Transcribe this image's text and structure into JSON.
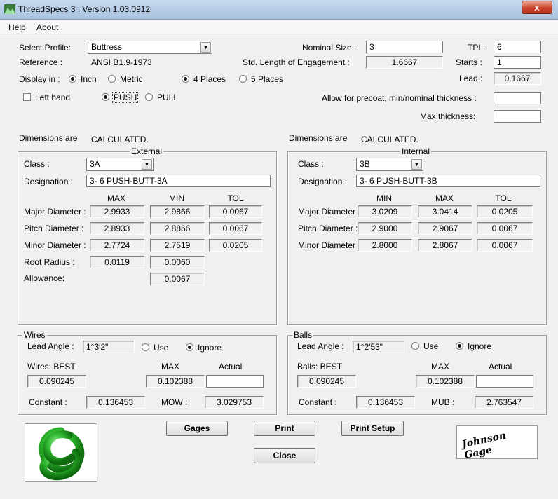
{
  "window": {
    "title": "ThreadSpecs 3 : Version 1.03.0912",
    "close": "x"
  },
  "menu": {
    "help": "Help",
    "about": "About"
  },
  "top": {
    "profile_label": "Select Profile:",
    "profile_value": "Buttress",
    "reference_label": "Reference :",
    "reference_value": "ANSI B1.9-1973",
    "display_label": "Display in :",
    "inch": "Inch",
    "metric": "Metric",
    "places4": "4 Places",
    "places5": "5 Places",
    "left_hand": "Left hand",
    "push": "PUSH",
    "pull": "PULL",
    "nominal_label": "Nominal Size :",
    "nominal_value": "3",
    "std_len_label": "Std. Length of Engagement :",
    "std_len_value": "1.6667",
    "tpi_label": "TPI :",
    "tpi_value": "6",
    "starts_label": "Starts :",
    "starts_value": "1",
    "lead_label": "Lead :",
    "lead_value": "0.1667",
    "precoat_label": "Allow for precoat, min/nominal thickness :",
    "max_thick_label": "Max thickness:"
  },
  "dims": {
    "label": "Dimensions are",
    "status": "CALCULATED."
  },
  "external": {
    "title": "External",
    "class_label": "Class :",
    "class_value": "3A",
    "designation_label": "Designation :",
    "designation_value": "3-  6  PUSH-BUTT-3A",
    "col1": "MAX",
    "col2": "MIN",
    "col3": "TOL",
    "rows": [
      {
        "label": "Major Diameter :",
        "a": "2.9933",
        "b": "2.9866",
        "c": "0.0067"
      },
      {
        "label": "Pitch Diameter :",
        "a": "2.8933",
        "b": "2.8866",
        "c": "0.0067"
      },
      {
        "label": "Minor Diameter :",
        "a": "2.7724",
        "b": "2.7519",
        "c": "0.0205"
      }
    ],
    "root_label": "Root Radius :",
    "root_a": "0.0119",
    "root_b": "0.0060",
    "allowance_label": "Allowance:",
    "allowance_value": "0.0067"
  },
  "internal": {
    "title": "Internal",
    "class_label": "Class :",
    "class_value": "3B",
    "designation_label": "Designation :",
    "designation_value": "3-  6  PUSH-BUTT-3B",
    "col1": "MIN",
    "col2": "MAX",
    "col3": "TOL",
    "rows": [
      {
        "label": "Major Diameter :",
        "a": "3.0209",
        "b": "3.0414",
        "c": "0.0205"
      },
      {
        "label": "Pitch Diameter :",
        "a": "2.9000",
        "b": "2.9067",
        "c": "0.0067"
      },
      {
        "label": "Minor Diameter :",
        "a": "2.8000",
        "b": "2.8067",
        "c": "0.0067"
      }
    ]
  },
  "wires": {
    "title": "Wires",
    "lead_label": "Lead Angle :",
    "lead_value": "1°3'2\"",
    "use": "Use",
    "ignore": "Ignore",
    "best_label": "Wires: BEST",
    "best_value": "0.090245",
    "max_label": "MAX",
    "max_value": "0.102388",
    "actual_label": "Actual",
    "actual_value": "",
    "constant_label": "Constant :",
    "constant_value": "0.136453",
    "mow_label": "MOW :",
    "mow_value": "3.029753"
  },
  "balls": {
    "title": "Balls",
    "lead_label": "Lead Angle :",
    "lead_value": "1°2'53\"",
    "use": "Use",
    "ignore": "Ignore",
    "best_label": "Balls: BEST",
    "best_value": "0.090245",
    "max_label": "MAX",
    "max_value": "0.102388",
    "actual_label": "Actual",
    "actual_value": "",
    "constant_label": "Constant :",
    "constant_value": "0.136453",
    "mub_label": "MUB :",
    "mub_value": "2.763547"
  },
  "buttons": {
    "gages": "Gages",
    "print": "Print",
    "print_setup": "Print Setup",
    "close": "Close"
  },
  "brand": {
    "logo_text": "Johnson Gage",
    "accent": "#2db52d"
  }
}
